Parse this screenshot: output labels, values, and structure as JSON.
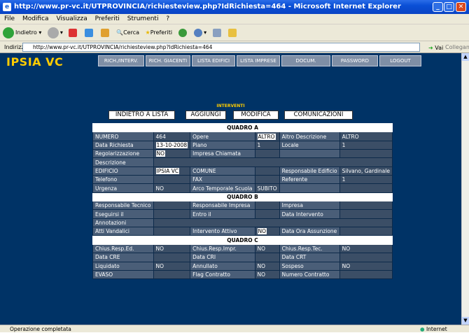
{
  "window": {
    "title": "http://www.pr-vc.it/UTPROVINCIA/richiesteview.php?IdRichiesta=464 - Microsoft Internet Explorer"
  },
  "menu": [
    "File",
    "Modifica",
    "Visualizza",
    "Preferiti",
    "Strumenti",
    "?"
  ],
  "toolbar": {
    "back": "Indietro",
    "search": "Cerca",
    "favorites": "Preferiti"
  },
  "address": {
    "label": "Indirizzo",
    "url": "http://www.pr-vc.it/UTPROVINCIA/richiesteview.php?IdRichiesta=464",
    "go": "Vai",
    "links": "Collegamenti"
  },
  "status": {
    "text": "Operazione completata",
    "zone": "Internet"
  },
  "page": {
    "logo": "IPSIA VC",
    "nav": [
      "RICH./INTERV.",
      "RICH. GIACENTI",
      "LISTA EDIFICI",
      "LISTA IMPRESE",
      "DOCUM.",
      "PASSWORD",
      "LOGOUT"
    ],
    "section_label": "INTERVENTI",
    "actions": {
      "back": "INDIETRO A LISTA",
      "add": "AGGIUNGI",
      "edit": "MODIFICA",
      "comm": "COMUNICAZIONI"
    }
  },
  "table": {
    "quadro_a": "QUADRO A",
    "quadro_b": "QUADRO B",
    "quadro_c": "QUADRO C",
    "rows": {
      "r1": [
        "NUMERO",
        "464",
        "Opere",
        "ALTRO",
        "Altro Descrizione",
        "ALTRO"
      ],
      "r2": [
        "Data Richiesta",
        "13-10-2008",
        "Piano",
        "1",
        "Locale",
        "1"
      ],
      "r3": [
        "Regolarizzazione",
        "NO",
        "Impresa Chiamata",
        "",
        "",
        ""
      ],
      "r4": [
        "Descrizione",
        "",
        "",
        "",
        "",
        ""
      ],
      "r5": [
        "EDIFICIO",
        "IPSIA VC",
        "COMUNE",
        "",
        "Responsabile Edificio",
        "Silvano, Gardinale"
      ],
      "r6": [
        "Telefono",
        "",
        "FAX",
        "",
        "Referente",
        "1"
      ],
      "r7": [
        "Urgenza",
        "NO",
        "Arco Temporale Scuola",
        "SUBITO",
        "",
        ""
      ],
      "b1": [
        "Responsabile Tecnico",
        "",
        "Responsabile Impresa",
        "",
        "Impresa",
        ""
      ],
      "b2": [
        "Eseguirsi il",
        "",
        "Entro il",
        "",
        "Data Intervento",
        ""
      ],
      "b3": [
        "Annotazioni",
        "",
        "",
        "",
        "",
        ""
      ],
      "b4": [
        "Atti Vandalici",
        "",
        "Intervento Attivo",
        "NO",
        "Data Ora Assunzione",
        ""
      ],
      "c1": [
        "Chius.Resp.Ed.",
        "NO",
        "Chius.Resp.Impr.",
        "NO",
        "Chius.Resp.Tec.",
        "NO"
      ],
      "c2": [
        "Data CRE",
        "",
        "Data CRI",
        "",
        "Data CRT",
        ""
      ],
      "c3": [
        "Liquidato",
        "NO",
        "Annullato",
        "NO",
        "Sospeso",
        "NO"
      ],
      "c4": [
        "EVASO",
        "",
        "Flag Contratto",
        "NO",
        "Numero Contratto",
        ""
      ]
    }
  }
}
